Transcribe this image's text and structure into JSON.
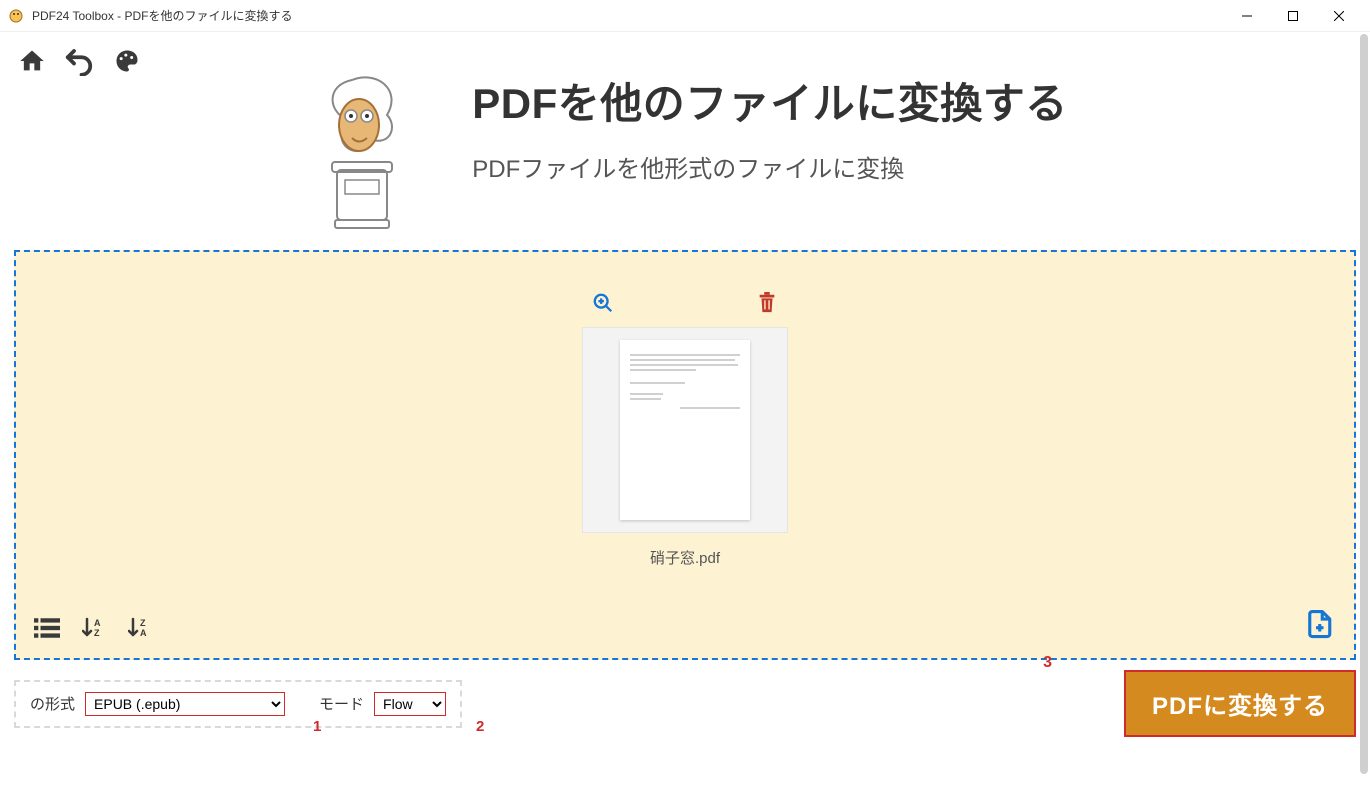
{
  "window": {
    "title": "PDF24 Toolbox - PDFを他のファイルに変換する"
  },
  "hero": {
    "title": "PDFを他のファイルに変換する",
    "subtitle": "PDFファイルを他形式のファイルに変換"
  },
  "file": {
    "name": "硝子窓.pdf"
  },
  "options": {
    "format_label": "の形式",
    "format_value": "EPUB (.epub)",
    "mode_label": "モード",
    "mode_value": "Flow"
  },
  "action": {
    "convert_label": "PDFに変換する"
  },
  "markers": {
    "m1": "1",
    "m2": "2",
    "m3": "3"
  }
}
